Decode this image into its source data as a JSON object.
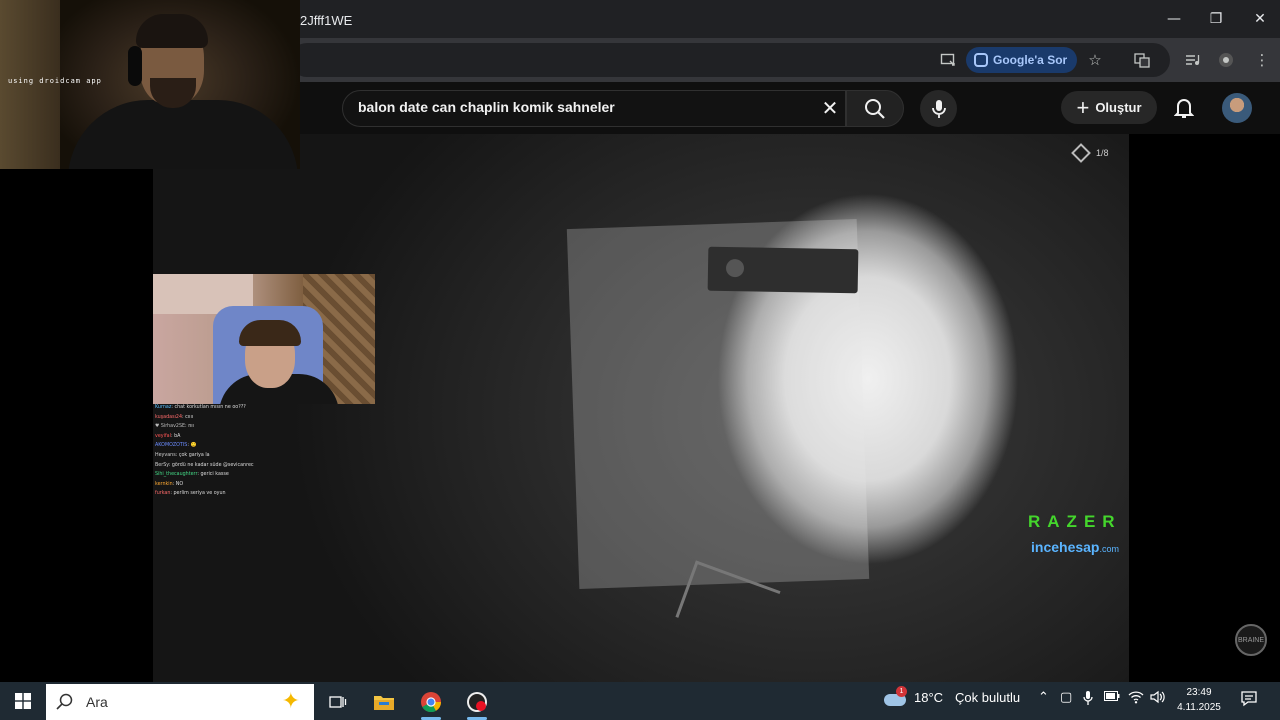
{
  "browser": {
    "url_fragment": "2Jfff1WE",
    "google_sor_label": "Google'a Sor",
    "window_controls": {
      "minimize": "—",
      "restore": "❐",
      "close": "✕"
    }
  },
  "youtube": {
    "search_query": "balon date can chaplin komik sahneler",
    "create_label": "Oluştur"
  },
  "video": {
    "counter": "1/8",
    "sponsor_razer": "RAZER",
    "sponsor_incehesap": "incehesap",
    "sponsor_incehesap_tld": ".com",
    "badge": "BRAINE"
  },
  "webcam": {
    "label": "using droidcam app"
  },
  "chat": {
    "lines": [
      {
        "user": "Kurnaz",
        "msg": ": chat korkutlan mısın ne oo???",
        "color": "#5bc0ff"
      },
      {
        "user": "kuşadası24",
        "msg": ": cıııı",
        "color": "#ff6b6b"
      },
      {
        "user": "♥ Sirhav2SE",
        "msg": ": nıı",
        "color": "#bbbbbb"
      },
      {
        "user": "veyifal",
        "msg": ": bA",
        "color": "#ff5555"
      },
      {
        "user": "AKOMOZOTIS",
        "msg": ": 🙂",
        "color": "#6b8cff"
      },
      {
        "user": "Heyvans",
        "msg": ": çok gariya la",
        "color": "#cfcfcf"
      },
      {
        "user": "BerSy",
        "msg": ": gördü ne kadar süde @sevicanrec",
        "color": "#cfcfcf"
      },
      {
        "user": "Sihi_thecaughterr",
        "msg": ": gerici kasse",
        "color": "#44dd88"
      },
      {
        "user": "kernkin",
        "msg": ": NO",
        "color": "#ffaa33"
      },
      {
        "user": "furkan",
        "msg": ": perlim seriya ve oyun",
        "color": "#ff6b6b"
      }
    ]
  },
  "taskbar": {
    "search_placeholder": "Ara",
    "weather_temp": "18°C",
    "weather_desc": "Çok bulutlu",
    "weather_badge": "1",
    "time": "23:49",
    "date": "4.11.2025"
  }
}
